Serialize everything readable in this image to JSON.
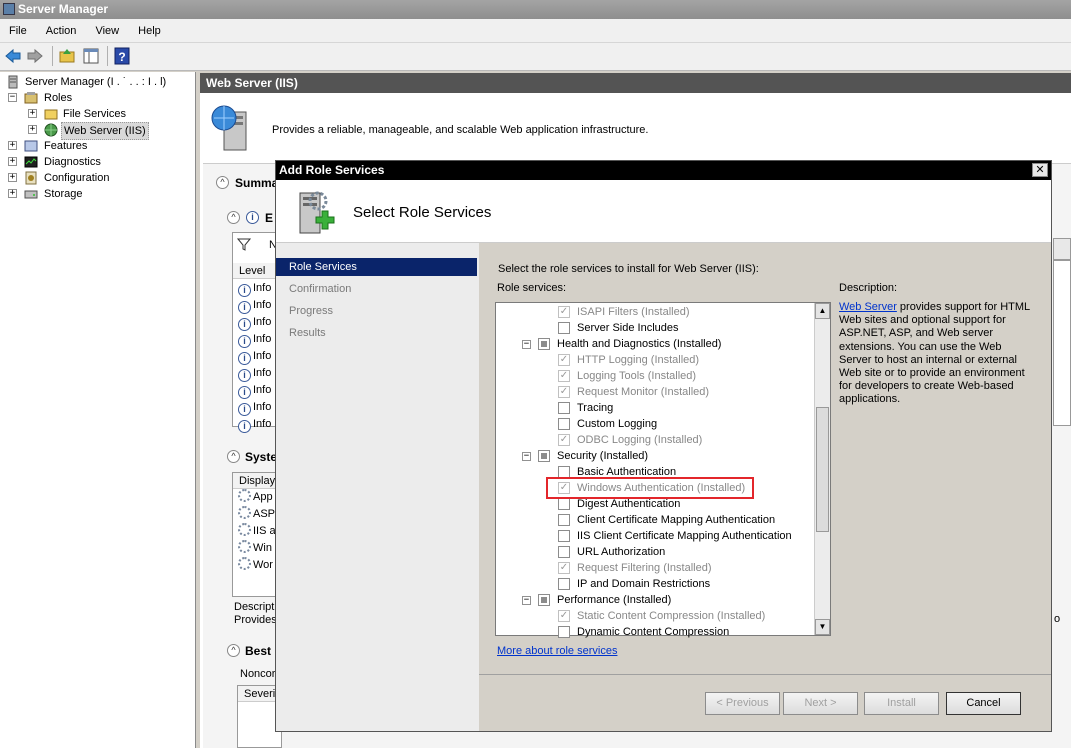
{
  "window": {
    "title": "Server Manager"
  },
  "menu": [
    "File",
    "Action",
    "View",
    "Help"
  ],
  "tree": {
    "root": "Server Manager (I . ˙ . . : I . l)",
    "roles": "Roles",
    "file_services": "File Services",
    "web_server": "Web Server (IIS)",
    "features": "Features",
    "diagnostics": "Diagnostics",
    "configuration": "Configuration",
    "storage": "Storage"
  },
  "right": {
    "header": "Web Server (IIS)",
    "description": "Provides a reliable, manageable, and scalable Web application infrastructure.",
    "summary": "Summa",
    "events_head": "E",
    "level_col": "Level",
    "filter_col": "N",
    "info_rows": [
      "Info",
      "Info",
      "Info",
      "Info",
      "Info",
      "Info",
      "Info",
      "Info",
      "Info"
    ],
    "system_head": "Syste",
    "display_col": "Display",
    "services": [
      "App",
      "ASP",
      "IIS a",
      "Win",
      "Wor"
    ],
    "desc_label": "Descript",
    "desc_value": "Provides",
    "best_head": "Best",
    "noncomp": "Noncor",
    "severity": "Severi",
    "side_frag": "o"
  },
  "dialog": {
    "title": "Add Role Services",
    "close": "✕",
    "header": "Select Role Services",
    "nav": [
      "Role Services",
      "Confirmation",
      "Progress",
      "Results"
    ],
    "instruction": "Select the role services to install for Web Server (IIS):",
    "role_services_label": "Role services:",
    "description_label": "Description:",
    "desc_link": "Web Server",
    "desc_text": " provides support for HTML Web sites and optional support for ASP.NET, ASP, and Web server extensions. You can use the Web Server to host an internal or external Web site or to provide an environment for developers to create Web-based applications.",
    "more_link": "More about role services",
    "buttons": {
      "previous": "< Previous",
      "next": "Next >",
      "install": "Install",
      "cancel": "Cancel"
    },
    "items": [
      {
        "label": "ISAPI Filters  (Installed)",
        "level": 2,
        "state": "checked-disabled"
      },
      {
        "label": "Server Side Includes",
        "level": 2,
        "state": "unchecked"
      },
      {
        "label": "Health and Diagnostics  (Installed)",
        "level": 1,
        "state": "partial"
      },
      {
        "label": "HTTP Logging  (Installed)",
        "level": 2,
        "state": "checked-disabled"
      },
      {
        "label": "Logging Tools  (Installed)",
        "level": 2,
        "state": "checked-disabled"
      },
      {
        "label": "Request Monitor  (Installed)",
        "level": 2,
        "state": "checked-disabled"
      },
      {
        "label": "Tracing",
        "level": 2,
        "state": "unchecked"
      },
      {
        "label": "Custom Logging",
        "level": 2,
        "state": "unchecked"
      },
      {
        "label": "ODBC Logging  (Installed)",
        "level": 2,
        "state": "checked-disabled"
      },
      {
        "label": "Security  (Installed)",
        "level": 1,
        "state": "partial"
      },
      {
        "label": "Basic Authentication",
        "level": 2,
        "state": "unchecked"
      },
      {
        "label": "Windows Authentication  (Installed)",
        "level": 2,
        "state": "checked-disabled"
      },
      {
        "label": "Digest Authentication",
        "level": 2,
        "state": "unchecked"
      },
      {
        "label": "Client Certificate Mapping Authentication",
        "level": 2,
        "state": "unchecked"
      },
      {
        "label": "IIS Client Certificate Mapping Authentication",
        "level": 2,
        "state": "unchecked"
      },
      {
        "label": "URL Authorization",
        "level": 2,
        "state": "unchecked"
      },
      {
        "label": "Request Filtering  (Installed)",
        "level": 2,
        "state": "checked-disabled"
      },
      {
        "label": "IP and Domain Restrictions",
        "level": 2,
        "state": "unchecked"
      },
      {
        "label": "Performance  (Installed)",
        "level": 1,
        "state": "partial"
      },
      {
        "label": "Static Content Compression  (Installed)",
        "level": 2,
        "state": "checked-disabled"
      },
      {
        "label": "Dynamic Content Compression",
        "level": 2,
        "state": "unchecked"
      }
    ]
  },
  "colors": {
    "accent": "#0a246a",
    "highlight": "#e3262b",
    "header": "#545454"
  }
}
